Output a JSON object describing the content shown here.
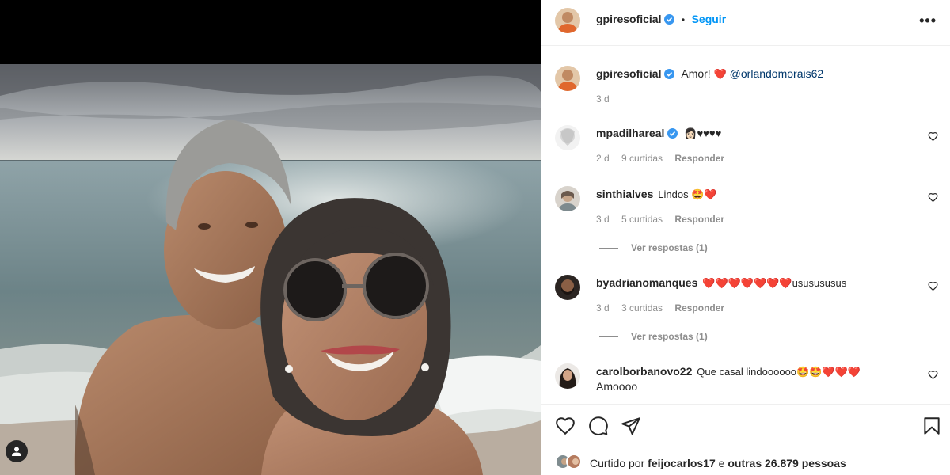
{
  "post": {
    "author": "gpiresoficial",
    "follow_label": "Seguir",
    "more_label": "•••",
    "separator": "•"
  },
  "caption": {
    "author": "gpiresoficial",
    "text": "Amor!",
    "heart": "❤️",
    "mention": "@orlandomorais62",
    "time": "3 d"
  },
  "comments": [
    {
      "user": "mpadilhareal",
      "text": "👩🏻♥♥♥♥",
      "time": "2 d",
      "likes": "9 curtidas",
      "reply": "Responder",
      "replies": ""
    },
    {
      "user": "sinthialves",
      "text": "Lindos 🤩❤️",
      "time": "3 d",
      "likes": "5 curtidas",
      "reply": "Responder",
      "replies": "Ver respostas (1)"
    },
    {
      "user": "byadrianomanques",
      "text": "❤️❤️❤️❤️❤️❤️❤️ususususus",
      "time": "3 d",
      "likes": "3 curtidas",
      "reply": "Responder",
      "replies": "Ver respostas (1)"
    },
    {
      "user": "carolborbanovo22",
      "text": "Que casal lindoooooo🤩🤩❤️❤️❤️",
      "text2": "Amoooo"
    }
  ],
  "likes": {
    "prefix": "Curtido por",
    "user": "feijocarlos17",
    "middle": "e",
    "others": "outras 26.879 pessoas"
  },
  "colors": {
    "accent": "#0095f6",
    "verified": "#3897f0",
    "heart": "#ed4956",
    "muted": "#8e8e8e"
  }
}
